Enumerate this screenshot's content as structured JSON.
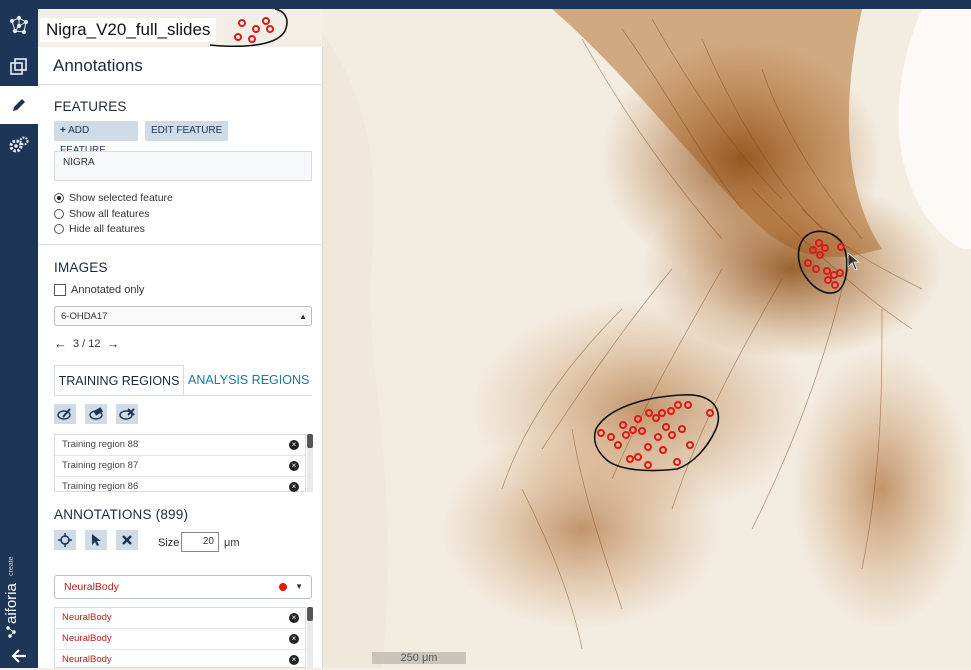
{
  "slide_title": "Nigra_V20_full_slides",
  "panel": {
    "title": "Annotations",
    "features": {
      "heading": "FEATURES",
      "add_button": "ADD FEATURE",
      "edit_button": "EDIT FEATURE",
      "selected": "NIGRA",
      "options": [
        "Show selected feature",
        "Show all features",
        "Hide all features"
      ]
    },
    "images": {
      "heading": "IMAGES",
      "annotated_only": "Annotated only",
      "selected": "6-OHDA17",
      "pager": "3 / 12"
    },
    "tabs": {
      "training": "TRAINING REGIONS",
      "analysis": "ANALYSIS REGIONS"
    },
    "regions": [
      "Training region 88",
      "Training region 87",
      "Training region 86"
    ],
    "annotations": {
      "heading": "ANNOTATIONS (899)",
      "size_label": "Size",
      "size_value": "20",
      "size_unit": "μm",
      "class_selected": "NeuralBody",
      "class_color": "#e01818",
      "items": [
        "NeuralBody",
        "NeuralBody",
        "NeuralBody"
      ]
    }
  },
  "rail": {
    "brand": "aiforia",
    "brand_sub": "create"
  },
  "viewer": {
    "scale": "250 μm"
  },
  "colors": {
    "rail": "#1d3557",
    "accent": "#1a7aa0",
    "annotation": "#e01818"
  }
}
